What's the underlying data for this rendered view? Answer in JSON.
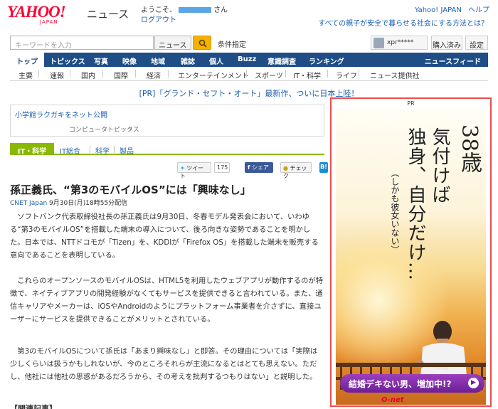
{
  "header": {
    "logo_text": "YAHOO!",
    "logo_sub": "JAPAN",
    "section_title": "ニュース",
    "welcome_prefix": "ようこそ、",
    "welcome_suffix": "さん",
    "logout": "ログアウト",
    "link_yahoo_japan": "Yahoo! JAPAN",
    "link_help": "ヘルプ",
    "promo_link": "すべての親子が安全で暮らせる社会にする方法とは？"
  },
  "search": {
    "placeholder": "キーワードを入力",
    "scope": "ニュース",
    "conditions": "条件指定",
    "username": "xpr*****",
    "btn_subscribed": "購入済み",
    "btn_settings": "設定"
  },
  "mainnav": {
    "items": [
      "トップ",
      "トピックス",
      "写真",
      "映像",
      "地域",
      "雑誌",
      "個人",
      "Buzz",
      "意識調査",
      "ランキング"
    ],
    "feed": "ニュースフィード"
  },
  "subnav": {
    "items": [
      "主要",
      "速報",
      "国内",
      "国際",
      "経済",
      "エンターテインメント",
      "スポーツ",
      "IT・科学",
      "ライフ",
      "ニュース提供社"
    ]
  },
  "pr_line": "[PR]「グランド・セフト・オート」最新作、ついに日本上陸！",
  "related_box": {
    "link": "小学館ラクガキをネット公開",
    "category": "コンピュータトピックス",
    "chevron": "⌄"
  },
  "category": {
    "tag": "IT・科学",
    "links": [
      "IT総合",
      "科学",
      "製品"
    ]
  },
  "social": {
    "tweet": "ツイート",
    "tweet_count": "175",
    "share": "シェア",
    "check": "チェック",
    "hatena": "B!"
  },
  "article": {
    "headline": "孫正義氏、“第3のモバイルOS”には「興味なし」",
    "source": "CNET Japan",
    "date": "9月30日(月)18時55分配信",
    "paragraphs": [
      "ソフトバンク代表取締役社長の孫正義氏は9月30日、冬春モデル発表会において、いわゆる“第3のモバイルOS”を搭載した端末の導入について、後ろ向きな姿勢であることを明かした。日本では、NTTドコモが「Tizen」を、KDDIが「Firefox OS」を搭載した端末を販売する意向であることを表明している。",
      "これらのオープンソースのモバイルOSは、HTML5を利用したウェブアプリが動作するのが特徴で、ネイティブアプリの開発経験がなくてもサービスを提供できると言われている。また、通信キャリアやメーカーは、iOSやAndroidのようにプラットフォーム事業者を介さずに、直接ユーザーにサービスを提供できることがメリットとされている。",
      "第3のモバイルOSについて孫氏は「あまり興味なし」と即答。その理由については「実際は少しくらいは扱うかもしれないが、今のところそれらが主流になるとはとても思えない。ただし、他社には他社の思惑があるだろうから、その考えを批判するつもりはない」と説明した。"
    ],
    "related_heading": "【関連記事】"
  },
  "ad": {
    "pr_label": "PR",
    "line1": "38歳",
    "line2": "気付けば",
    "line3": "独身、自分だけ…",
    "line4": "（しかも彼女いない）",
    "cta": "結婚デキない男、増加中!?",
    "cta_arrow": "▶",
    "brand": "O-net"
  },
  "colors": {
    "logo_red": "#ff0033",
    "nav_blue": "#1f4d86",
    "link_blue": "#1b5fb0",
    "category_green": "#8ab800",
    "ad_border": "#ee4d4d",
    "cta_purple": "#6d1f96"
  }
}
